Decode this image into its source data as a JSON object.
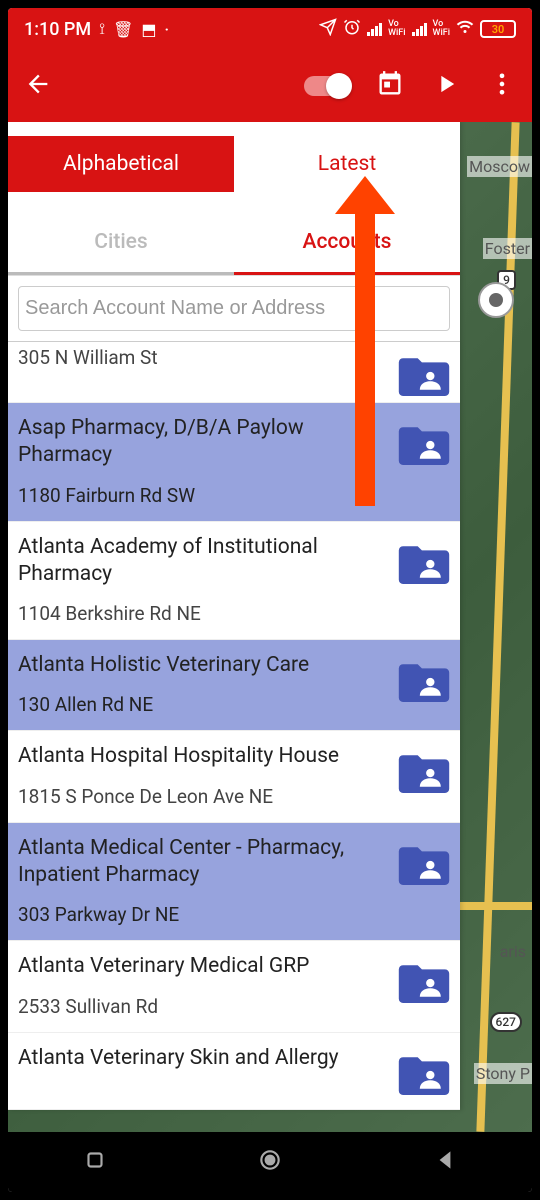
{
  "status": {
    "time": "1:10 PM",
    "battery": "30"
  },
  "sort_tabs": {
    "alphabetical": "Alphabetical",
    "latest": "Latest"
  },
  "filter_tabs": {
    "cities": "Cities",
    "accounts": "Accounts"
  },
  "search": {
    "placeholder": "Search Account Name or Address"
  },
  "map": {
    "labels": {
      "moscow": "Moscow",
      "foster": "Foster",
      "aris": "aris",
      "stony": "Stony P"
    },
    "roads": {
      "r9": "9",
      "r627": "627"
    }
  },
  "accounts": [
    {
      "name": "",
      "address": "305 N William St",
      "highlighted": false,
      "partialTop": true
    },
    {
      "name": "Asap Pharmacy, D/B/A Paylow Pharmacy",
      "address": "1180 Fairburn Rd SW",
      "highlighted": true
    },
    {
      "name": "Atlanta Academy of Institutional Pharmacy",
      "address": "1104 Berkshire Rd NE",
      "highlighted": false
    },
    {
      "name": "Atlanta Holistic Veterinary Care",
      "address": "130 Allen Rd NE",
      "highlighted": true
    },
    {
      "name": "Atlanta Hospital Hospitality House",
      "address": "1815 S Ponce De Leon Ave NE",
      "highlighted": false
    },
    {
      "name": "Atlanta Medical Center - Pharmacy, Inpatient Pharmacy",
      "address": "303 Parkway Dr NE",
      "highlighted": true
    },
    {
      "name": "Atlanta Veterinary Medical GRP",
      "address": "2533 Sullivan Rd",
      "highlighted": false
    },
    {
      "name": "Atlanta Veterinary Skin and Allergy",
      "address": "",
      "highlighted": false,
      "partialBottom": true
    }
  ]
}
